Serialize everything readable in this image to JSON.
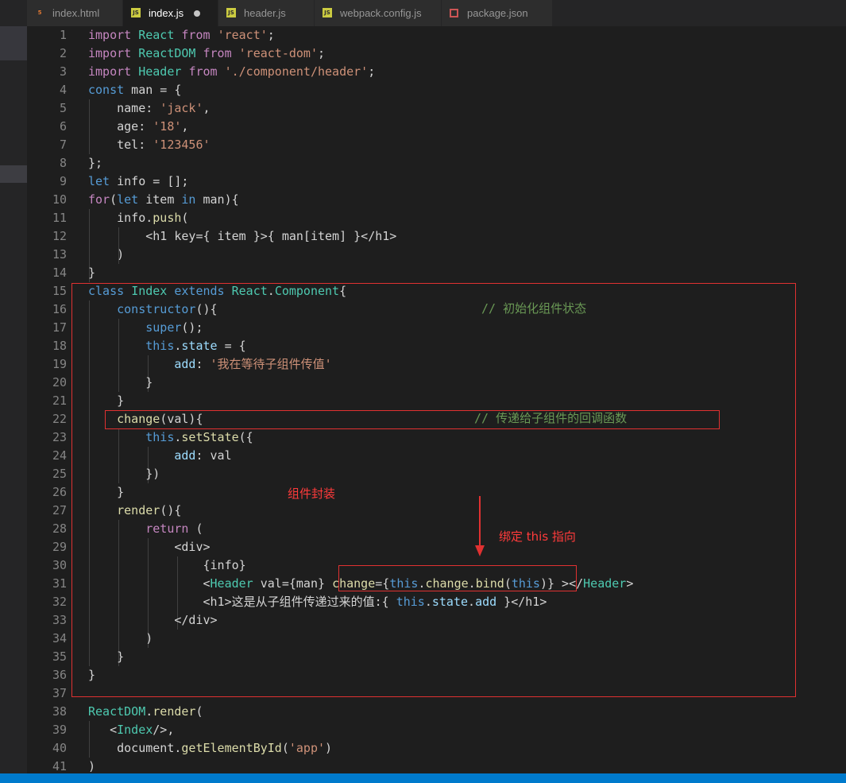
{
  "tabs": [
    {
      "label": "index.html",
      "icon": "html-file-icon"
    },
    {
      "label": "index.js",
      "icon": "js-file-icon",
      "modified": true
    },
    {
      "label": "header.js",
      "icon": "js-file-icon"
    },
    {
      "label": "webpack.config.js",
      "icon": "js-file-icon"
    },
    {
      "label": "package.json",
      "icon": "json-file-icon"
    }
  ],
  "lines": [
    {
      "n": "1",
      "t": "import React from 'react';"
    },
    {
      "n": "2",
      "t": "import ReactDOM from 'react-dom';"
    },
    {
      "n": "3",
      "t": "import Header from './component/header';"
    },
    {
      "n": "4",
      "t": "const man = {"
    },
    {
      "n": "5",
      "t": "    name: 'jack',"
    },
    {
      "n": "6",
      "t": "    age: '18',"
    },
    {
      "n": "7",
      "t": "    tel: '123456'"
    },
    {
      "n": "8",
      "t": "};"
    },
    {
      "n": "9",
      "t": "let info = [];"
    },
    {
      "n": "10",
      "t": "for(let item in man){"
    },
    {
      "n": "11",
      "t": "    info.push("
    },
    {
      "n": "12",
      "t": "        <h1 key={ item }>{ man[item] }</h1>"
    },
    {
      "n": "13",
      "t": "    )"
    },
    {
      "n": "14",
      "t": "}"
    },
    {
      "n": "15",
      "t": "class Index extends React.Component{"
    },
    {
      "n": "16",
      "t": "    constructor(){"
    },
    {
      "n": "17",
      "t": "        super();"
    },
    {
      "n": "18",
      "t": "        this.state = {"
    },
    {
      "n": "19",
      "t": "            add: '我在等待子组件传值'"
    },
    {
      "n": "20",
      "t": "        }"
    },
    {
      "n": "21",
      "t": "    }"
    },
    {
      "n": "22",
      "t": "    change(val){"
    },
    {
      "n": "23",
      "t": "        this.setState({"
    },
    {
      "n": "24",
      "t": "            add: val"
    },
    {
      "n": "25",
      "t": "        })"
    },
    {
      "n": "26",
      "t": "    }"
    },
    {
      "n": "27",
      "t": "    render(){"
    },
    {
      "n": "28",
      "t": "        return ("
    },
    {
      "n": "29",
      "t": "            <div>"
    },
    {
      "n": "30",
      "t": "                {info}"
    },
    {
      "n": "31",
      "t": "                <Header val={man} change={this.change.bind(this)} ></Header>"
    },
    {
      "n": "32",
      "t": "                <h1>这是从子组件传递过来的值:{ this.state.add }</h1>"
    },
    {
      "n": "33",
      "t": "            </div>"
    },
    {
      "n": "34",
      "t": "        )"
    },
    {
      "n": "35",
      "t": "    }"
    },
    {
      "n": "36",
      "t": "}"
    },
    {
      "n": "37",
      "t": ""
    },
    {
      "n": "38",
      "t": "ReactDOM.render("
    },
    {
      "n": "39",
      "t": "   <Index/>,"
    },
    {
      "n": "40",
      "t": "    document.getElementById('app')"
    },
    {
      "n": "41",
      "t": ")"
    }
  ],
  "comments": {
    "init_state": "// 初始化组件状态",
    "callback": "// 传递给子组件的回调函数"
  },
  "annotations": {
    "wrap": "组件封装",
    "bind": "绑定 this 指向"
  },
  "colors": {
    "annotation_red": "#e03131",
    "status_bar": "#007acc"
  }
}
